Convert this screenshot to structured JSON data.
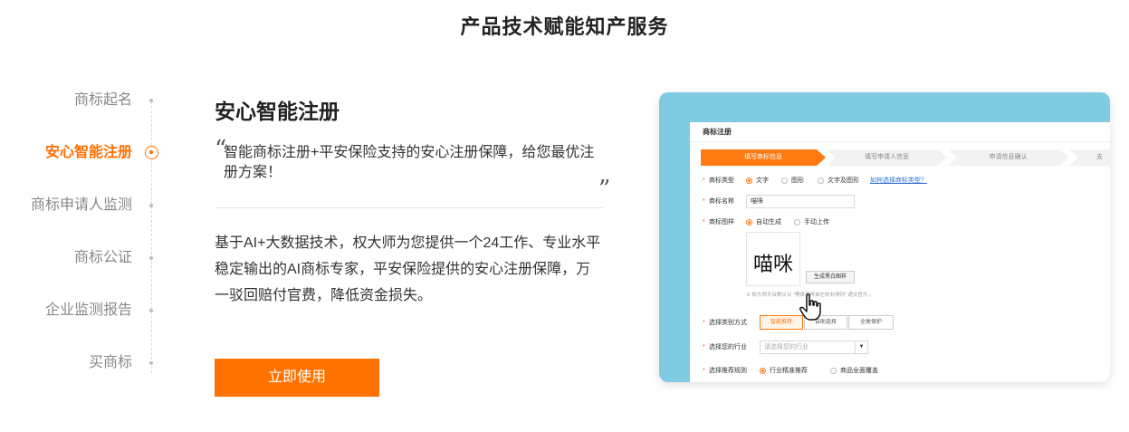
{
  "page": {
    "title": "产品技术赋能知产服务"
  },
  "nav": {
    "items": [
      {
        "label": "商标起名",
        "active": false
      },
      {
        "label": "安心智能注册",
        "active": true
      },
      {
        "label": "商标申请人监测",
        "active": false
      },
      {
        "label": "商标公证",
        "active": false
      },
      {
        "label": "企业监测报告",
        "active": false
      },
      {
        "label": "买商标",
        "active": false
      }
    ]
  },
  "content": {
    "title": "安心智能注册",
    "quote_open": "“",
    "quote": "智能商标注册+平安保险支持的安心注册保障，给您最优注册方案！",
    "quote_close": "”",
    "description": "基于AI+大数据技术，权大师为您提供一个24工作、专业水平稳定输出的AI商标专家，平安保险提供的安心注册保障，万一驳回赔付官费，降低资金损失。",
    "cta_label": "立即使用"
  },
  "preview": {
    "form_title": "商标注册",
    "steps": [
      "填写商标信息",
      "填写申请人信息",
      "申请信息确认",
      "支"
    ],
    "fields": {
      "type_label": "商标类型",
      "type_options": [
        "文字",
        "图形",
        "文字及图形"
      ],
      "type_help_link": "如何选择商标类型？",
      "name_label": "商标名称",
      "name_value": "喵咪",
      "pattern_label": "商标图样",
      "pattern_options": [
        "自动生成",
        "手动上传"
      ],
      "pattern_preview": "喵咪",
      "generate_button": "生成黑白图样",
      "hint": "① 权大师平台默认以 \"黑体字样自左向右排列\" 递交官方 。",
      "category_label": "选择类别方式",
      "category_options": [
        "智能推荐",
        "自助选择",
        "全类保护"
      ],
      "industry_label": "选择您的行业",
      "industry_placeholder": "请选择您的行业",
      "rule_label": "选择推荐规则",
      "rule_options": [
        "行业精准推荐",
        "商品全面覆盖"
      ]
    }
  },
  "colors": {
    "accent": "#ff7200",
    "preview_bg": "#7fcbe2"
  }
}
